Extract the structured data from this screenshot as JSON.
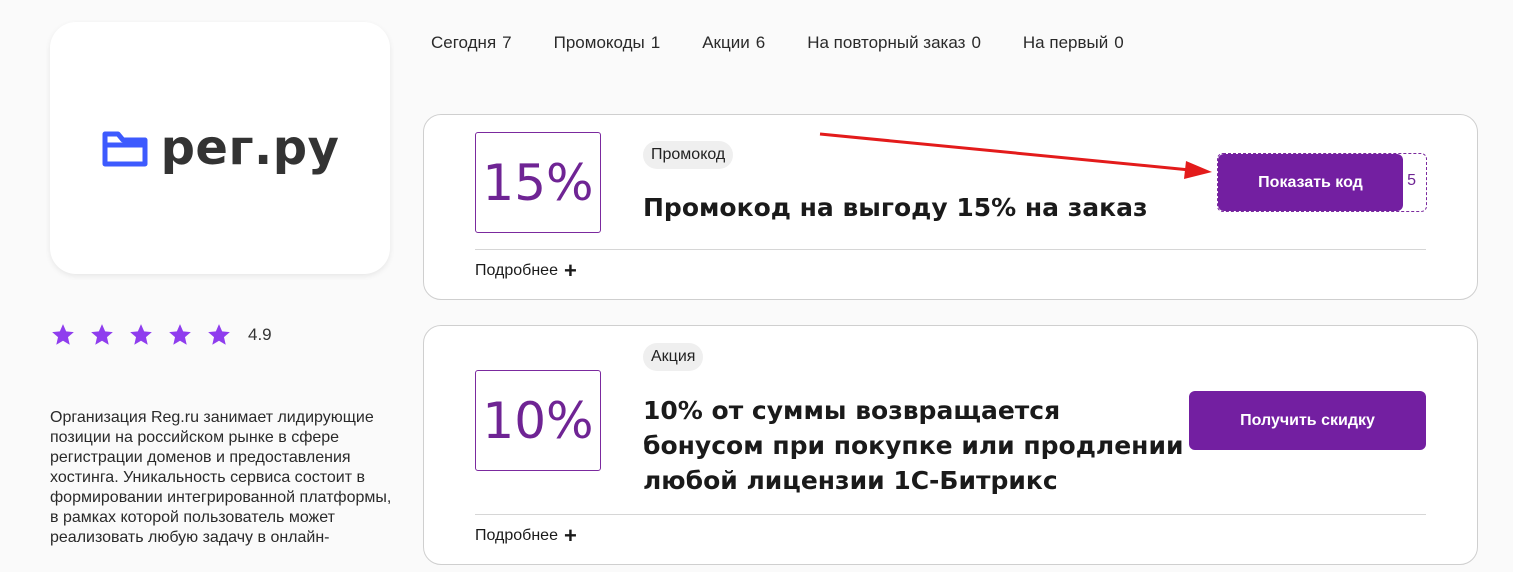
{
  "brand": {
    "logo_text": "рег.ру",
    "icon": "folder-icon",
    "color": "#3d5afe"
  },
  "rating": {
    "value": "4.9",
    "stars": 5,
    "star_color": "#8f3dee"
  },
  "description": "Организация Reg.ru занимает лидирующие позиции на российском рынке в сфере регистрации доменов и предоставления хостинга. Уникальность сервиса состоит в формировании интегрированной платформы, в рамках которой пользователь может реализовать любую задачу в онлайн-",
  "tabs": [
    {
      "label": "Сегодня",
      "count": "7"
    },
    {
      "label": "Промокоды",
      "count": "1"
    },
    {
      "label": "Акции",
      "count": "6"
    },
    {
      "label": "На повторный заказ",
      "count": "0"
    },
    {
      "label": "На первый",
      "count": "0"
    }
  ],
  "offers": [
    {
      "percent": "15%",
      "badge": "Промокод",
      "title": "Промокод на выгоду 15% на заказ",
      "more": "Подробнее",
      "button": "Показать код",
      "code_hint": "5"
    },
    {
      "percent": "10%",
      "badge": "Акция",
      "title": "10% от суммы возвращается бонусом при покупке или продлении любой лицензии 1С-Битрикс",
      "more": "Подробнее",
      "button": "Получить скидку"
    }
  ],
  "colors": {
    "accent": "#731fa1",
    "arrow": "#e31b1b"
  }
}
